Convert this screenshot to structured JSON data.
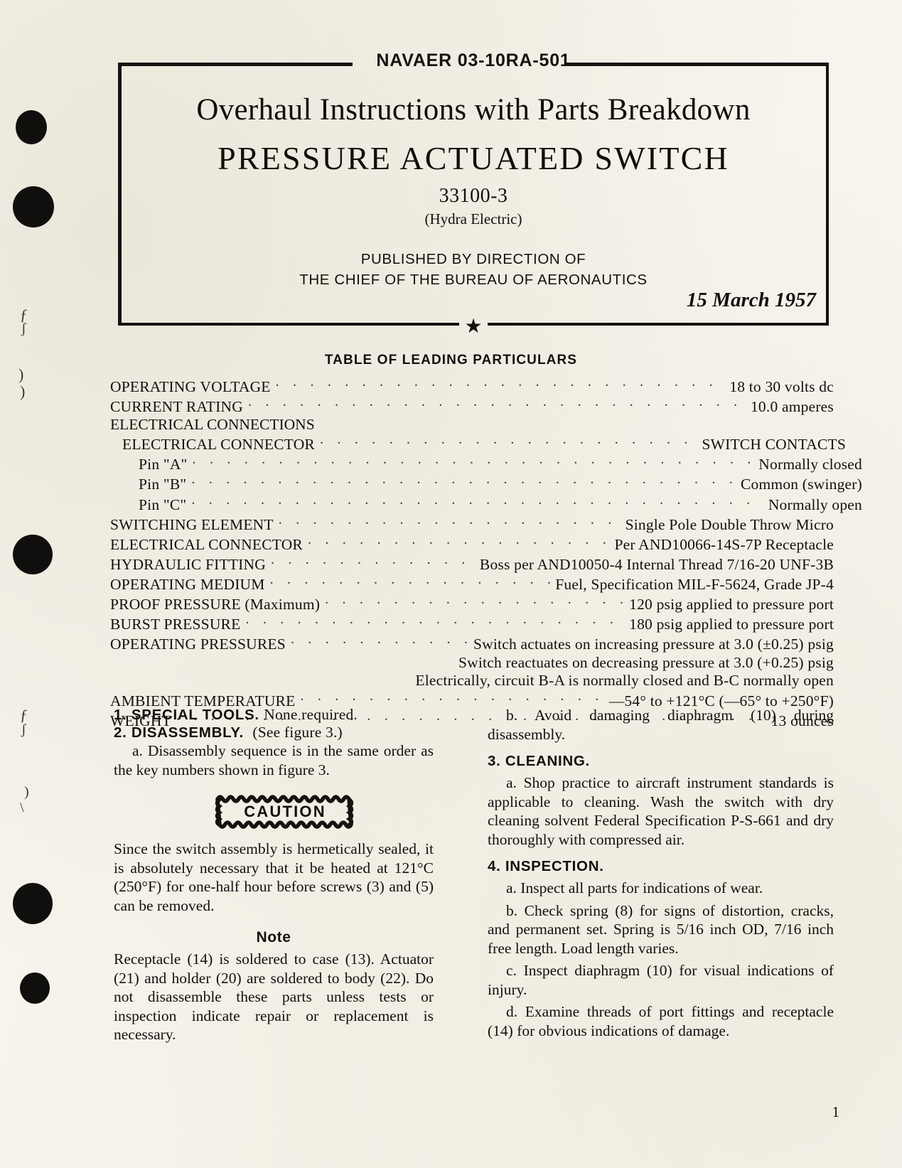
{
  "document": {
    "doc_number": "NAVAER 03-10RA-501",
    "title_line": "Overhaul Instructions with Parts Breakdown",
    "product_title": "PRESSURE ACTUATED SWITCH",
    "part_number": "33100-3",
    "manufacturer": "(Hydra Electric)",
    "published_line1": "PUBLISHED BY DIRECTION OF",
    "published_line2": "THE CHIEF OF THE BUREAU OF AERONAUTICS",
    "date": "15 March 1957",
    "star_glyph": "★",
    "page_number": "1"
  },
  "table": {
    "heading": "TABLE OF LEADING PARTICULARS",
    "rows": [
      {
        "label": "OPERATING  VOLTAGE",
        "value": "18 to 30 volts dc",
        "indent": 0,
        "leader": true
      },
      {
        "label": "CURRENT RATING",
        "value": "10.0  amperes",
        "indent": 0,
        "leader": true
      },
      {
        "label": "ELECTRICAL CONNECTIONS",
        "value": "",
        "indent": 0,
        "leader": false
      },
      {
        "label": "ELECTRICAL CONNECTOR",
        "value": "SWITCH  CONTACTS",
        "indent": 1,
        "leader": true
      },
      {
        "label": "Pin \"A\"",
        "value": "Normally closed",
        "indent": 2,
        "leader": true
      },
      {
        "label": "Pin \"B\"",
        "value": "Common   (swinger)",
        "indent": 2,
        "leader": true
      },
      {
        "label": "Pin \"C\"",
        "value": "Normally  open",
        "indent": 2,
        "leader": true
      },
      {
        "label": "SWITCHING  ELEMENT",
        "value": "Single Pole Double Throw Micro",
        "indent": 0,
        "leader": true
      },
      {
        "label": "ELECTRICAL   CONNECTOR",
        "value": "Per  AND10066-14S-7P  Receptacle",
        "indent": 0,
        "leader": true
      },
      {
        "label": "HYDRAULIC  FITTING",
        "value": "Boss per AND10050-4 Internal Thread 7/16-20 UNF-3B",
        "indent": 0,
        "leader": true
      },
      {
        "label": "OPERATING  MEDIUM",
        "value": "Fuel, Specification MIL-F-5624, Grade JP-4",
        "indent": 0,
        "leader": true
      },
      {
        "label": "PROOF PRESSURE (Maximum)",
        "value": "120 psig applied to pressure port",
        "indent": 0,
        "leader": true
      },
      {
        "label": "BURST PRESSURE",
        "value": "180 psig applied to pressure port",
        "indent": 0,
        "leader": true
      },
      {
        "label": "OPERATING   PRESSURES",
        "value": "Switch actuates on increasing pressure at 3.0 (±0.25) psig",
        "indent": 0,
        "leader": true
      }
    ],
    "pressure_continuation": [
      "Switch reactuates on decreasing pressure at 3.0 (+0.25) psig",
      "Electrically, circuit B-A is normally closed and B-C normally open"
    ],
    "rows_tail": [
      {
        "label": "AMBIENT TEMPERATURE",
        "value": "—54° to +121°C (—65° to +250°F)",
        "indent": 0,
        "leader": true
      },
      {
        "label": "WEIGHT",
        "value": "13  ounces",
        "indent": 0,
        "leader": true
      }
    ]
  },
  "sections": {
    "special_tools": {
      "number": "1.",
      "heading": "SPECIAL TOOLS.",
      "text": "None required."
    },
    "disassembly": {
      "number": "2.",
      "heading": "DISASSEMBLY.",
      "text": "(See figure 3.)",
      "item_a": "a. Disassembly sequence is in the same order as the key numbers shown in figure 3.",
      "item_b": "b. Avoid damaging diaphragm (10) during disassembly."
    },
    "caution": {
      "label": "CAUTION",
      "text": "Since the switch assembly is hermetically sealed, it is absolutely necessary that it be heated at 121°C (250°F) for one-half hour before screws (3) and (5) can be removed."
    },
    "note": {
      "label": "Note",
      "text": "Receptacle (14) is soldered to case (13). Actuator (21) and holder (20) are soldered to body (22). Do not disassemble these parts unless tests or inspection indicate repair or replacement is necessary."
    },
    "cleaning": {
      "number": "3.",
      "heading": "CLEANING.",
      "item_a": "a. Shop practice to aircraft instrument standards is applicable to cleaning. Wash the switch with dry cleaning solvent Federal Specification P-S-661 and dry thoroughly with compressed air."
    },
    "inspection": {
      "number": "4.",
      "heading": "INSPECTION.",
      "item_a": "a. Inspect all parts for indications of wear.",
      "item_b": "b. Check spring (8) for signs of distortion, cracks, and permanent set. Spring is 5/16 inch OD, 7/16 inch free length. Load length varies.",
      "item_c": "c. Inspect diaphragm (10) for visual indications of injury.",
      "item_d": "d. Examine threads of port fittings and receptacle (14) for obvious indications of damage."
    }
  },
  "margin_marks": {
    "m1": "ƒ",
    "m2": "ʃ",
    "m3": ")",
    "m4": ")",
    "m5": "ƒ",
    "m6": "ʃ",
    "m7": ")",
    "m8": "\\"
  }
}
